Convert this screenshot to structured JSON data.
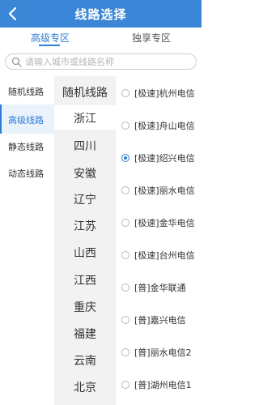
{
  "header": {
    "title": "线路选择",
    "back_icon": "chevron-left-icon"
  },
  "tabs": [
    {
      "label": "高级专区",
      "active": true
    },
    {
      "label": "独享专区",
      "active": false
    }
  ],
  "search": {
    "placeholder": "请输入城市或线路名称",
    "value": "",
    "icon": "search-icon"
  },
  "left_nav": [
    {
      "label": "随机线路",
      "active": false
    },
    {
      "label": "高级线路",
      "active": true
    },
    {
      "label": "静态线路",
      "active": false
    },
    {
      "label": "动态线路",
      "active": false
    }
  ],
  "provinces": [
    {
      "label": "随机线路",
      "active": false
    },
    {
      "label": "浙江",
      "active": true
    },
    {
      "label": "四川",
      "active": false
    },
    {
      "label": "安徽",
      "active": false
    },
    {
      "label": "辽宁",
      "active": false
    },
    {
      "label": "江苏",
      "active": false
    },
    {
      "label": "山西",
      "active": false
    },
    {
      "label": "江西",
      "active": false
    },
    {
      "label": "重庆",
      "active": false
    },
    {
      "label": "福建",
      "active": false
    },
    {
      "label": "云南",
      "active": false
    },
    {
      "label": "北京",
      "active": false
    }
  ],
  "lines": [
    {
      "label": "[极速]杭州电信",
      "selected": false
    },
    {
      "label": "[极速]舟山电信",
      "selected": false
    },
    {
      "label": "[极速]绍兴电信",
      "selected": true
    },
    {
      "label": "[极速]丽水电信",
      "selected": false
    },
    {
      "label": "[极速]金华电信",
      "selected": false
    },
    {
      "label": "[极速]台州电信",
      "selected": false
    },
    {
      "label": "[普]金华联通",
      "selected": false
    },
    {
      "label": "[普]嘉兴电信",
      "selected": false
    },
    {
      "label": "[普]丽水电信2",
      "selected": false
    },
    {
      "label": "[普]湖州电信1",
      "selected": false
    }
  ],
  "colors": {
    "accent": "#2e7fd8",
    "header_bg": "#3b86d6",
    "mid_bg": "#f2f2f2"
  }
}
